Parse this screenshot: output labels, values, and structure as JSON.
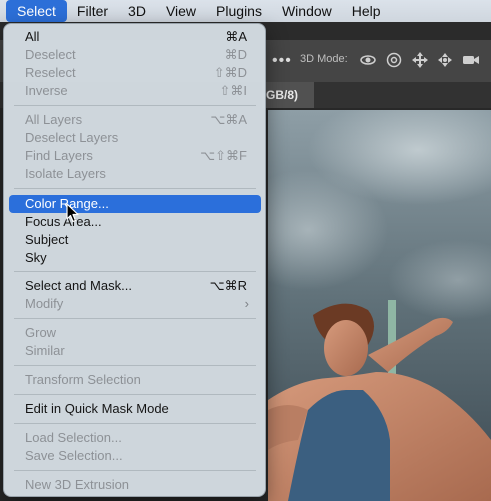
{
  "menubar": {
    "items": [
      "Select",
      "Filter",
      "3D",
      "View",
      "Plugins",
      "Window",
      "Help"
    ],
    "active": "Select"
  },
  "options_bar": {
    "dots": "•••",
    "mode_label": "3D Mode:",
    "icons": [
      "orbit-icon",
      "roll-icon",
      "pan-icon",
      "slide-icon",
      "camera-video-icon"
    ]
  },
  "document_tab": {
    "label_prefix": "GB/8)",
    "suffix": ""
  },
  "select_menu": {
    "items": [
      {
        "label": "All",
        "shortcut": "⌘A",
        "enabled": true
      },
      {
        "label": "Deselect",
        "shortcut": "⌘D",
        "enabled": false
      },
      {
        "label": "Reselect",
        "shortcut": "⇧⌘D",
        "enabled": false
      },
      {
        "label": "Inverse",
        "shortcut": "⇧⌘I",
        "enabled": false
      },
      {
        "label": "All Layers",
        "shortcut": "⌥⌘A",
        "enabled": false
      },
      {
        "label": "Deselect Layers",
        "shortcut": "",
        "enabled": false
      },
      {
        "label": "Find Layers",
        "shortcut": "⌥⇧⌘F",
        "enabled": false
      },
      {
        "label": "Isolate Layers",
        "shortcut": "",
        "enabled": false
      },
      {
        "label": "Color Range...",
        "shortcut": "",
        "enabled": true,
        "highlighted": true
      },
      {
        "label": "Focus Area...",
        "shortcut": "",
        "enabled": true
      },
      {
        "label": "Subject",
        "shortcut": "",
        "enabled": true
      },
      {
        "label": "Sky",
        "shortcut": "",
        "enabled": true
      },
      {
        "label": "Select and Mask...",
        "shortcut": "⌥⌘R",
        "enabled": true
      },
      {
        "label": "Modify",
        "shortcut": "",
        "enabled": false,
        "submenu": true
      },
      {
        "label": "Grow",
        "shortcut": "",
        "enabled": false
      },
      {
        "label": "Similar",
        "shortcut": "",
        "enabled": false
      },
      {
        "label": "Transform Selection",
        "shortcut": "",
        "enabled": false
      },
      {
        "label": "Edit in Quick Mask Mode",
        "shortcut": "",
        "enabled": true
      },
      {
        "label": "Load Selection...",
        "shortcut": "",
        "enabled": false
      },
      {
        "label": "Save Selection...",
        "shortcut": "",
        "enabled": false
      },
      {
        "label": "New 3D Extrusion",
        "shortcut": "",
        "enabled": false
      }
    ],
    "submenu_arrow": "›"
  },
  "colors": {
    "highlight": "#2b6fdb",
    "menu_bg": "#d4dce2",
    "disabled_text": "#8d9196",
    "app_panel": "#454545"
  }
}
